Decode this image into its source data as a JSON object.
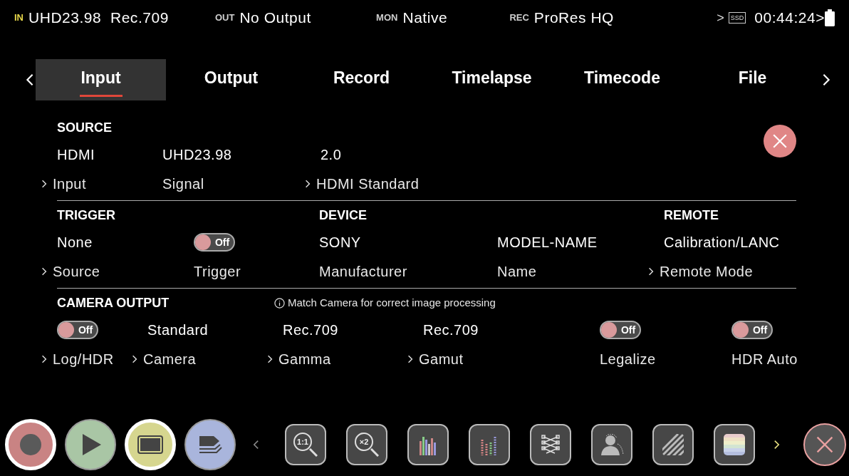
{
  "status_bar": [
    {
      "tag": "IN",
      "kind": "input",
      "text": "UHD23.98  Rec.709"
    },
    {
      "tag": "OUT",
      "kind": "output",
      "text": "No Output"
    },
    {
      "tag": "MON",
      "kind": "monitor",
      "text": "Native"
    },
    {
      "tag": "REC",
      "kind": "record",
      "text": "ProRes HQ"
    }
  ],
  "storage": {
    "prefix": ">",
    "media": "SSD",
    "time": "00:44:24>"
  },
  "tabs": [
    {
      "label": "Input",
      "selected": true
    },
    {
      "label": "Output",
      "selected": false
    },
    {
      "label": "Record",
      "selected": false
    },
    {
      "label": "Timelapse",
      "selected": false
    },
    {
      "label": "Timecode",
      "selected": false
    },
    {
      "label": "File",
      "selected": false
    }
  ],
  "sections": [
    {
      "fields": [
        {
          "heading": "SOURCE",
          "kind": "text",
          "value": "HDMI",
          "label": "Input",
          "link": true
        },
        {
          "kind": "text",
          "value": "UHD23.98",
          "label": "Signal",
          "link": false
        },
        {
          "kind": "text",
          "value": "2.0",
          "label": "HDMI Standard",
          "link": true
        }
      ]
    },
    {
      "fields": [
        {
          "heading": "TRIGGER",
          "kind": "text",
          "value": "None",
          "label": "Source",
          "link": true
        },
        {
          "kind": "toggle",
          "on": false,
          "value": "Off",
          "label": "Trigger",
          "link": false
        },
        {
          "heading": "DEVICE",
          "kind": "text",
          "value": "SONY",
          "label": "Manufacturer",
          "link": false
        },
        {
          "kind": "text",
          "value": "MODEL-NAME",
          "label": "Name",
          "link": false
        },
        {
          "heading": "REMOTE",
          "kind": "text",
          "value": "Calibration/LANC",
          "label": "Remote Mode",
          "link": true
        }
      ]
    },
    {
      "fields": [
        {
          "heading": "CAMERA OUTPUT",
          "kind": "toggle",
          "on": false,
          "value": "Off",
          "label": "Log/HDR",
          "link": true
        },
        {
          "kind": "text",
          "value": "Standard",
          "label": "Camera",
          "link": true
        },
        {
          "note": "Match Camera for correct image processing",
          "kind": "text",
          "value": "Rec.709",
          "label": "Gamma",
          "link": true
        },
        {
          "kind": "text",
          "value": "Rec.709",
          "label": "Gamut",
          "link": true
        },
        {
          "kind": "toggle",
          "on": false,
          "value": "Off",
          "label": "Legalize",
          "link": false
        },
        {
          "kind": "toggle",
          "on": false,
          "value": "Off",
          "label": "HDR Auto",
          "link": false
        }
      ]
    }
  ],
  "transport": [
    {
      "kind": "record",
      "active": true
    },
    {
      "kind": "play",
      "active": false
    },
    {
      "kind": "monitor",
      "active": true
    },
    {
      "kind": "tag",
      "active": false
    }
  ],
  "tools": [
    {
      "kind": "zoom",
      "text": "1:1"
    },
    {
      "kind": "zoom",
      "text": "×2"
    },
    {
      "kind": "histogram"
    },
    {
      "kind": "audio"
    },
    {
      "kind": "corner"
    },
    {
      "kind": "focus"
    },
    {
      "kind": "zebra"
    },
    {
      "kind": "false_color"
    }
  ]
}
